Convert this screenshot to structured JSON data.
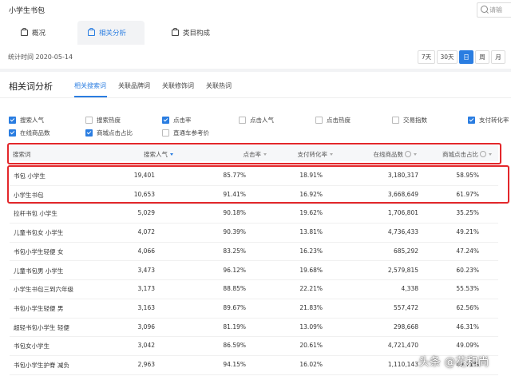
{
  "app_title": "小学生书包",
  "search_placeholder": "请输",
  "tabs": [
    {
      "label": "概况",
      "active": false
    },
    {
      "label": "相关分析",
      "active": true
    },
    {
      "label": "类目构成",
      "active": false
    }
  ],
  "stat_time": "统计时间 2020-05-14",
  "periods": [
    {
      "label": "7天",
      "active": false
    },
    {
      "label": "30天",
      "active": false
    },
    {
      "label": "日",
      "active": true
    },
    {
      "label": "周",
      "active": false
    },
    {
      "label": "月",
      "active": false
    }
  ],
  "section_title": "相关词分析",
  "subtabs": [
    {
      "label": "相关搜索词",
      "active": true
    },
    {
      "label": "关联品牌词",
      "active": false
    },
    {
      "label": "关联修饰词",
      "active": false
    },
    {
      "label": "关联热词",
      "active": false
    }
  ],
  "metrics": [
    {
      "label": "搜索人气",
      "checked": true
    },
    {
      "label": "搜索热度",
      "checked": false
    },
    {
      "label": "点击率",
      "checked": true
    },
    {
      "label": "点击人气",
      "checked": false
    },
    {
      "label": "点击热度",
      "checked": false
    },
    {
      "label": "交易指数",
      "checked": false
    },
    {
      "label": "支付转化率",
      "checked": true
    },
    {
      "label": "在线商品数",
      "checked": true
    },
    {
      "label": "商城点击占比",
      "checked": true
    },
    {
      "label": "直通车参考价",
      "checked": false
    }
  ],
  "columns": [
    "搜索词",
    "搜索人气",
    "点击率",
    "支付转化率",
    "在线商品数",
    "商城点击占比"
  ],
  "rows": [
    [
      "书包 小学生",
      "19,401",
      "85.77%",
      "18.91%",
      "3,180,317",
      "58.95%"
    ],
    [
      "小学生书包",
      "10,653",
      "91.41%",
      "16.92%",
      "3,668,649",
      "61.97%"
    ],
    [
      "拉杆书包 小学生",
      "5,029",
      "90.18%",
      "19.62%",
      "1,706,801",
      "35.25%"
    ],
    [
      "儿童书包女 小学生",
      "4,072",
      "90.39%",
      "13.81%",
      "4,736,433",
      "49.21%"
    ],
    [
      "书包小学生轻便 女",
      "4,066",
      "83.25%",
      "16.23%",
      "685,292",
      "47.24%"
    ],
    [
      "儿童书包男 小学生",
      "3,473",
      "96.12%",
      "19.68%",
      "2,579,815",
      "60.23%"
    ],
    [
      "小学生书包三到六年级",
      "3,173",
      "88.85%",
      "22.21%",
      "4,338",
      "55.53%"
    ],
    [
      "书包小学生轻便 男",
      "3,163",
      "89.67%",
      "21.83%",
      "557,472",
      "62.56%"
    ],
    [
      "超轻书包小学生 轻便",
      "3,096",
      "81.19%",
      "13.09%",
      "298,668",
      "46.31%"
    ],
    [
      "书包女小学生",
      "3,042",
      "86.59%",
      "20.61%",
      "4,721,470",
      "49.09%"
    ],
    [
      "书包小学生护脊 减负",
      "2,963",
      "94.15%",
      "16.02%",
      "1,110,143",
      "49.71%"
    ]
  ],
  "watermark": "头条 @花和尚",
  "colors": {
    "accent": "#2a7de1",
    "highlight": "#e3272b"
  }
}
